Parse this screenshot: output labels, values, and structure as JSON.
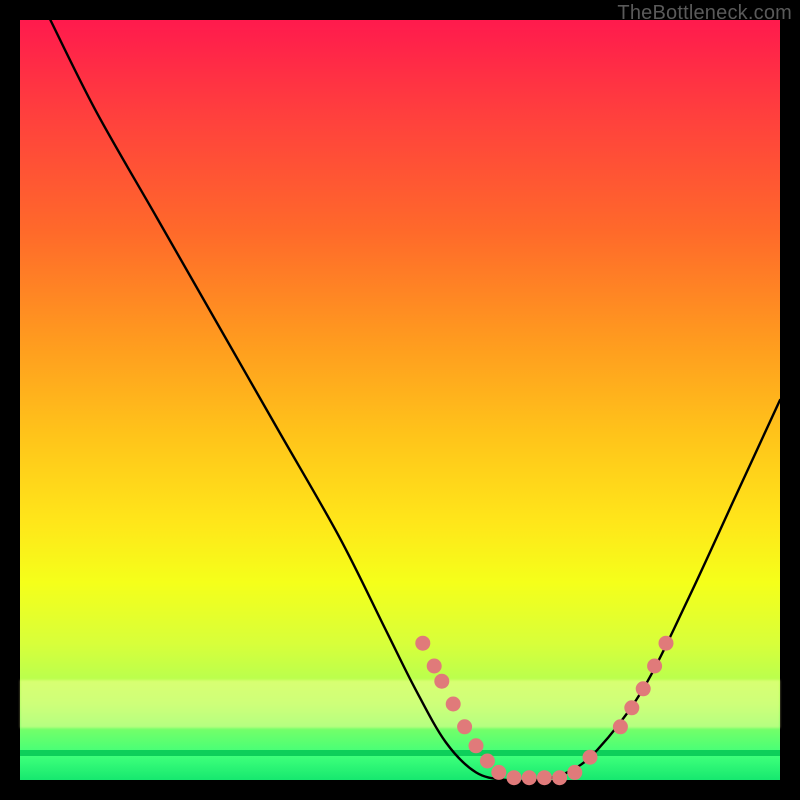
{
  "attribution": "TheBottleneck.com",
  "chart_data": {
    "type": "line",
    "title": "",
    "xlabel": "",
    "ylabel": "",
    "xlim": [
      0,
      100
    ],
    "ylim": [
      0,
      100
    ],
    "series": [
      {
        "name": "bottleneck-curve",
        "x": [
          4,
          10,
          18,
          26,
          34,
          42,
          48,
          52,
          56,
          60,
          64,
          68,
          72,
          76,
          82,
          88,
          94,
          100
        ],
        "y": [
          100,
          88,
          74,
          60,
          46,
          32,
          20,
          12,
          5,
          1,
          0,
          0,
          1,
          4,
          12,
          24,
          37,
          50
        ]
      }
    ],
    "markers": {
      "name": "highlight-markers",
      "color": "#e07a7a",
      "points": [
        {
          "x": 53,
          "y": 18
        },
        {
          "x": 54.5,
          "y": 15
        },
        {
          "x": 55.5,
          "y": 13
        },
        {
          "x": 57,
          "y": 10
        },
        {
          "x": 58.5,
          "y": 7
        },
        {
          "x": 60,
          "y": 4.5
        },
        {
          "x": 61.5,
          "y": 2.5
        },
        {
          "x": 63,
          "y": 1
        },
        {
          "x": 65,
          "y": 0.3
        },
        {
          "x": 67,
          "y": 0.3
        },
        {
          "x": 69,
          "y": 0.3
        },
        {
          "x": 71,
          "y": 0.3
        },
        {
          "x": 73,
          "y": 1
        },
        {
          "x": 75,
          "y": 3
        },
        {
          "x": 79,
          "y": 7
        },
        {
          "x": 80.5,
          "y": 9.5
        },
        {
          "x": 82,
          "y": 12
        },
        {
          "x": 83.5,
          "y": 15
        },
        {
          "x": 85,
          "y": 18
        }
      ]
    },
    "background": {
      "type": "vertical-gradient",
      "stops": [
        {
          "pos": 0,
          "color": "#ff1a4d"
        },
        {
          "pos": 50,
          "color": "#ffc51a"
        },
        {
          "pos": 80,
          "color": "#f5ff1a"
        },
        {
          "pos": 100,
          "color": "#16e86f"
        }
      ]
    }
  }
}
